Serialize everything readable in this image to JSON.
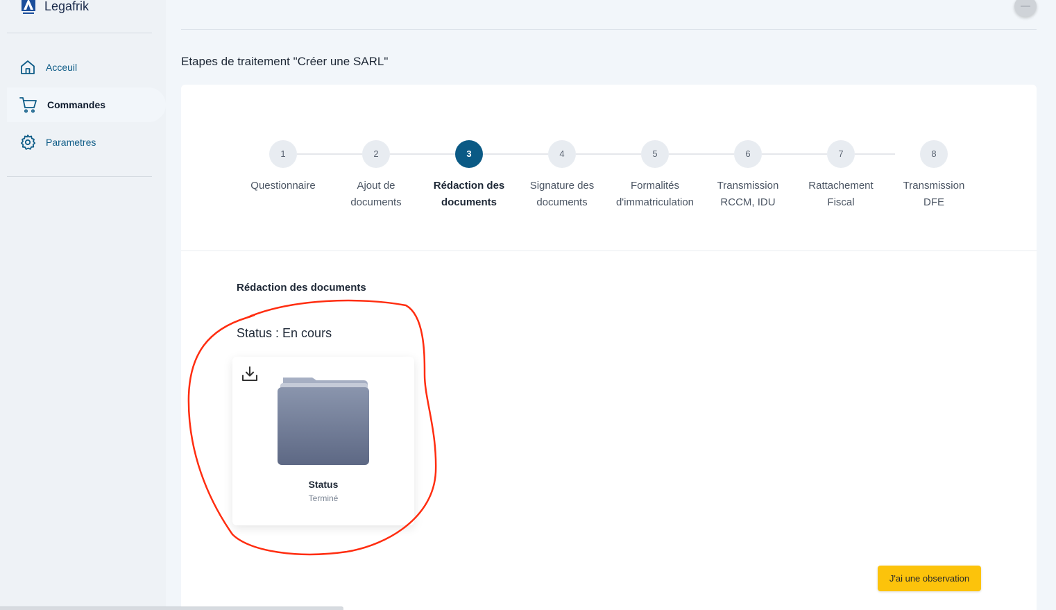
{
  "brand": {
    "name": "Legafrik",
    "logo_text": "Legafrik"
  },
  "sidebar": {
    "items": [
      {
        "label": "Acceuil",
        "icon": "home-icon"
      },
      {
        "label": "Commandes",
        "icon": "cart-icon"
      },
      {
        "label": "Parametres",
        "icon": "gear-icon"
      }
    ]
  },
  "page": {
    "title": "Etapes de traitement \"Créer une SARL\""
  },
  "stepper": {
    "active_step": 3,
    "steps": [
      {
        "number": "1",
        "label": "Questionnaire"
      },
      {
        "number": "2",
        "label": "Ajout de\ndocuments"
      },
      {
        "number": "3",
        "label": "Rédaction des\ndocuments"
      },
      {
        "number": "4",
        "label": "Signature des\ndocuments"
      },
      {
        "number": "5",
        "label": "Formalités\nd'immatriculation"
      },
      {
        "number": "6",
        "label": "Transmission\nRCCM, IDU"
      },
      {
        "number": "7",
        "label": "Rattachement\nFiscal"
      },
      {
        "number": "8",
        "label": "Transmission\nDFE"
      }
    ]
  },
  "section": {
    "title": "Rédaction des documents",
    "status": "Status : En cours"
  },
  "document": {
    "name": "Status",
    "state": "Terminé",
    "icons": {
      "download": "download-icon",
      "folder": "folder-icon"
    }
  },
  "actions": {
    "observation_label": "J'ai une observation"
  },
  "colors": {
    "primary": "#0b5a85",
    "accent": "#fcc30b",
    "annotation": "#ff2d10"
  }
}
